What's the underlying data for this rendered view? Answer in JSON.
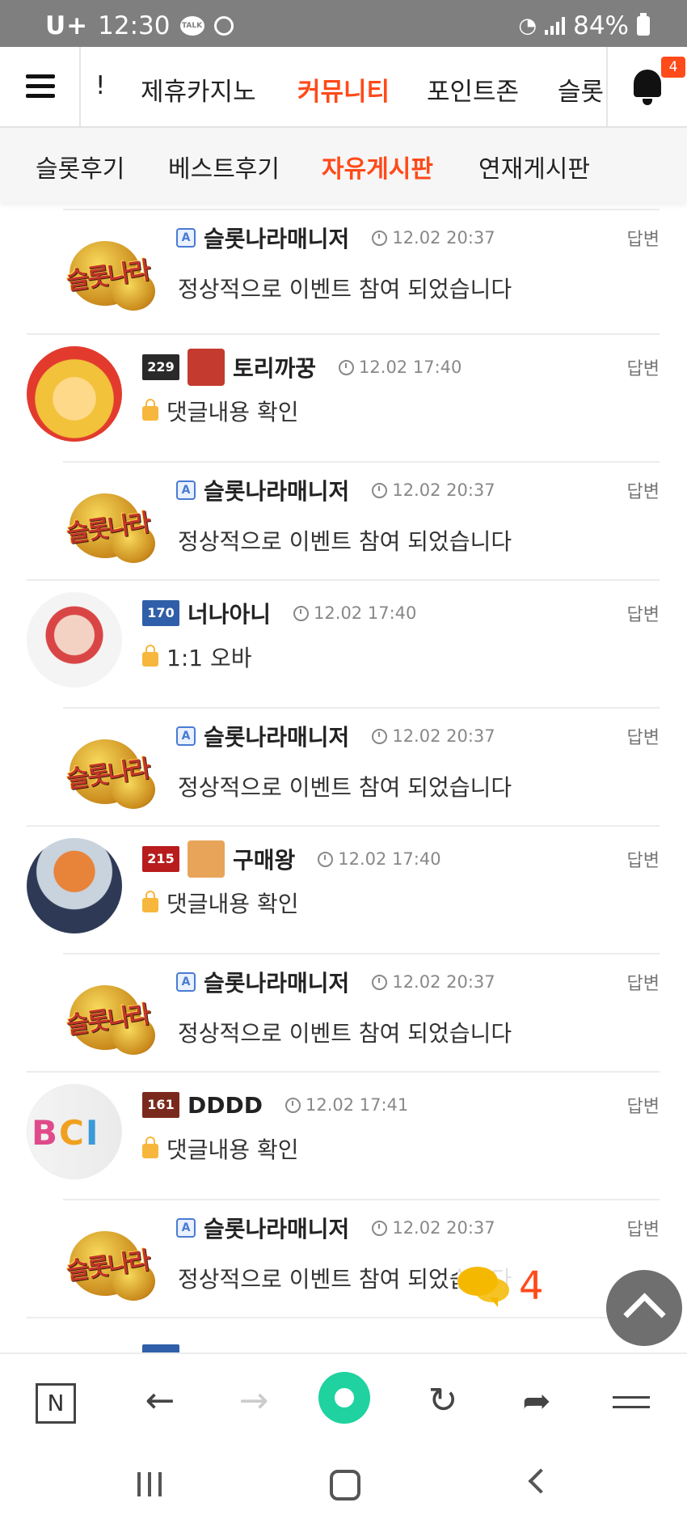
{
  "status_bar": {
    "carrier": "U+",
    "time": "12:30",
    "talk_icon": "TALK",
    "battery": "84%"
  },
  "top_nav": {
    "tabs": [
      {
        "label": "!"
      },
      {
        "label": "제휴카지노"
      },
      {
        "label": "커뮤니티"
      },
      {
        "label": "포인트존"
      },
      {
        "label": "슬롯"
      }
    ],
    "active_tab": "커뮤니티",
    "notification_count": "4"
  },
  "sub_nav": {
    "tabs": [
      {
        "label": "슬롯후기"
      },
      {
        "label": "베스트후기"
      },
      {
        "label": "자유게시판"
      },
      {
        "label": "연재게시판"
      }
    ],
    "active_tab": "자유게시판"
  },
  "comments": [
    {
      "type": "reply",
      "badge": "A",
      "nickname": "슬롯나라매니저",
      "time": "12.02 20:37",
      "action": "답변",
      "text": "정상적으로 이벤트 참여 되었습니다",
      "logo_text": "슬롯나라"
    },
    {
      "type": "main",
      "level": "229",
      "level_color": "#2a2a2a",
      "nickname": "토리까꿍",
      "time": "12.02 17:40",
      "action": "답변",
      "text": "댓글내용 확인",
      "secret": true,
      "avatar_color": "#f2c23a"
    },
    {
      "type": "reply",
      "badge": "A",
      "nickname": "슬롯나라매니저",
      "time": "12.02 20:37",
      "action": "답변",
      "text": "정상적으로 이벤트 참여 되었습니다",
      "logo_text": "슬롯나라"
    },
    {
      "type": "main",
      "level": "170",
      "level_color": "#2f5fa8",
      "nickname": "너나아니",
      "time": "12.02 17:40",
      "action": "답변",
      "text": "1:1 오바",
      "secret": true,
      "avatar_color": "#d94545"
    },
    {
      "type": "reply",
      "badge": "A",
      "nickname": "슬롯나라매니저",
      "time": "12.02 20:37",
      "action": "답변",
      "text": "정상적으로 이벤트 참여 되었습니다",
      "logo_text": "슬롯나라"
    },
    {
      "type": "main",
      "level": "215",
      "level_color": "#b81c1c",
      "nickname": "구매왕",
      "time": "12.02 17:40",
      "action": "답변",
      "text": "댓글내용 확인",
      "secret": true,
      "avatar_color": "#e8833a"
    },
    {
      "type": "reply",
      "badge": "A",
      "nickname": "슬롯나라매니저",
      "time": "12.02 20:37",
      "action": "답변",
      "text": "정상적으로 이벤트 참여 되었습니다",
      "logo_text": "슬롯나라"
    },
    {
      "type": "main",
      "level": "161",
      "level_color": "#7a2a1c",
      "nickname": "DDDD",
      "time": "12.02 17:41",
      "action": "답변",
      "text": "댓글내용 확인",
      "secret": true,
      "avatar_color": "#f0f0f0"
    },
    {
      "type": "reply",
      "badge": "A",
      "nickname": "슬롯나라매니저",
      "time": "12.02 20:37",
      "action": "답변",
      "text": "정상적으로 이벤트 참여 되었습니다",
      "logo_text": "슬롯나라"
    }
  ],
  "floating": {
    "chat_count": "4"
  },
  "browser_bar": {
    "n_label": "N"
  }
}
